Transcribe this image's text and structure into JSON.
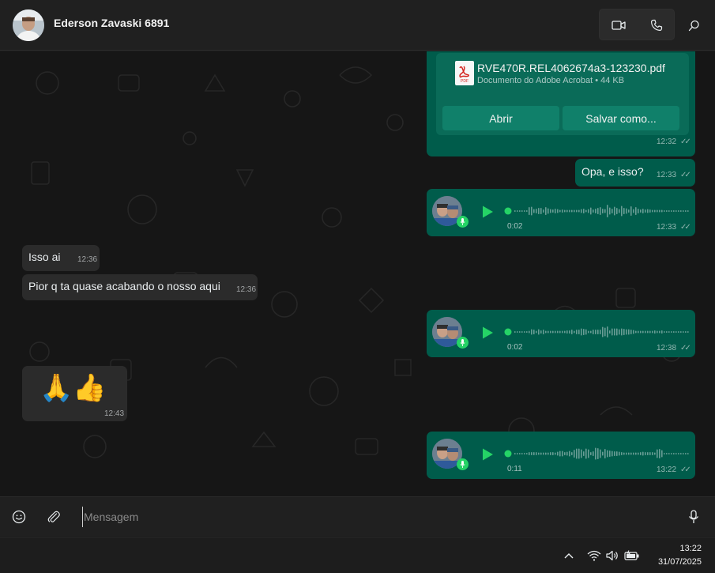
{
  "header": {
    "contact_name": "Ederson Zavaski 6891",
    "avatar_icon": "avatar-photo",
    "actions": [
      "video-call-icon",
      "phone-icon",
      "search-icon"
    ]
  },
  "messages": {
    "document": {
      "file_name": "RVE470R.REL4062674a3-123230.pdf",
      "meta": "Documento do Adobe Acrobat • 44 KB",
      "icon_label": "PDF",
      "open_label": "Abrir",
      "save_label": "Salvar como...",
      "time": "12:32"
    },
    "opa": {
      "text": "Opa, e isso?",
      "time": "12:33"
    },
    "voice1": {
      "duration": "0:02",
      "time": "12:33",
      "played_fraction": 0.0
    },
    "isso_ai": {
      "text": "Isso ai",
      "time": "12:36"
    },
    "pior": {
      "text": "Pior q ta quase acabando o nosso aqui",
      "time": "12:36"
    },
    "voice2": {
      "duration": "0:02",
      "time": "12:38",
      "played_fraction": 0.0
    },
    "emoji_msg": {
      "text": "🙏👍",
      "time": "12:43"
    },
    "voice3": {
      "duration": "0:11",
      "time": "13:22",
      "played_fraction": 0.0
    }
  },
  "composer": {
    "placeholder": "Mensagem",
    "value": ""
  },
  "taskbar": {
    "time": "13:22",
    "date": "31/07/2025"
  },
  "colors": {
    "outgoing_bubble": "#005c4b",
    "incoming_bubble": "#2b2b2b",
    "accent": "#25d366"
  }
}
